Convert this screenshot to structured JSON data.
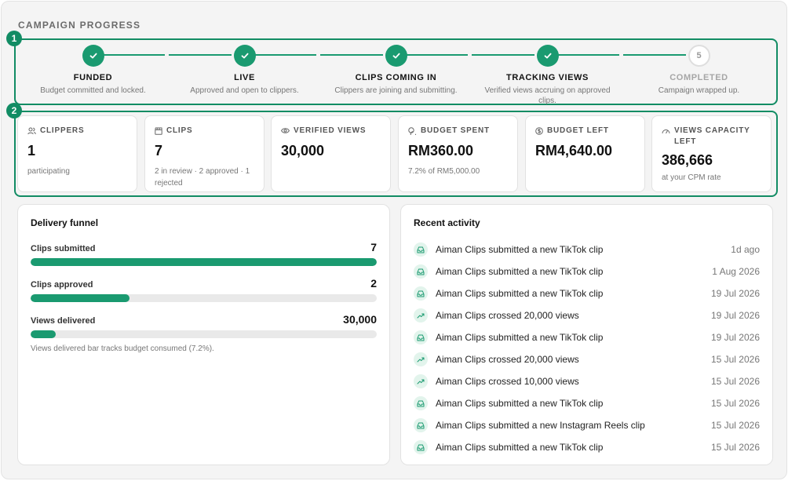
{
  "section_title": "CAMPAIGN PROGRESS",
  "markers": [
    "1",
    "2"
  ],
  "steps": [
    {
      "label": "FUNDED",
      "subtitle": "Budget committed and locked.",
      "state": "done"
    },
    {
      "label": "LIVE",
      "subtitle": "Approved and open to clippers.",
      "state": "done"
    },
    {
      "label": "CLIPS COMING IN",
      "subtitle": "Clippers are joining and submitting.",
      "state": "done"
    },
    {
      "label": "TRACKING VIEWS",
      "subtitle": "Verified views accruing on approved clips.",
      "state": "done"
    },
    {
      "label": "COMPLETED",
      "subtitle": "Campaign wrapped up.",
      "state": "pending",
      "number": "5"
    }
  ],
  "stats": [
    {
      "label": "CLIPPERS",
      "value": "1",
      "note": "participating",
      "icon": "users-icon"
    },
    {
      "label": "CLIPS",
      "value": "7",
      "note": "2 in review · 2 approved · 1 rejected",
      "icon": "clapperboard-icon"
    },
    {
      "label": "VERIFIED VIEWS",
      "value": "30,000",
      "note": "",
      "icon": "eye-icon"
    },
    {
      "label": "BUDGET SPENT",
      "value": "RM360.00",
      "note": "7.2% of RM5,000.00",
      "icon": "coins-icon"
    },
    {
      "label": "BUDGET LEFT",
      "value": "RM4,640.00",
      "note": "",
      "icon": "dollar-circle-icon"
    },
    {
      "label": "VIEWS CAPACITY LEFT",
      "value": "386,666",
      "note": "at your CPM rate",
      "icon": "gauge-icon"
    }
  ],
  "funnel": {
    "title": "Delivery funnel",
    "rows": [
      {
        "label": "Clips submitted",
        "value": "7",
        "fill_fraction": 1.0
      },
      {
        "label": "Clips approved",
        "value": "2",
        "fill_fraction": 0.2857
      },
      {
        "label": "Views delivered",
        "value": "30,000",
        "fill_fraction": 0.072
      }
    ],
    "note": "Views delivered bar tracks budget consumed (7.2%)."
  },
  "activity": {
    "title": "Recent activity",
    "items": [
      {
        "text": "Aiman Clips submitted a new TikTok clip",
        "time": "1d ago",
        "icon": "inbox-icon"
      },
      {
        "text": "Aiman Clips submitted a new TikTok clip",
        "time": "1 Aug 2026",
        "icon": "inbox-icon"
      },
      {
        "text": "Aiman Clips submitted a new TikTok clip",
        "time": "19 Jul 2026",
        "icon": "inbox-icon"
      },
      {
        "text": "Aiman Clips crossed 20,000 views",
        "time": "19 Jul 2026",
        "icon": "trending-up-icon"
      },
      {
        "text": "Aiman Clips submitted a new TikTok clip",
        "time": "19 Jul 2026",
        "icon": "inbox-icon"
      },
      {
        "text": "Aiman Clips crossed 20,000 views",
        "time": "15 Jul 2026",
        "icon": "trending-up-icon"
      },
      {
        "text": "Aiman Clips crossed 10,000 views",
        "time": "15 Jul 2026",
        "icon": "trending-up-icon"
      },
      {
        "text": "Aiman Clips submitted a new TikTok clip",
        "time": "15 Jul 2026",
        "icon": "inbox-icon"
      },
      {
        "text": "Aiman Clips submitted a new Instagram Reels clip",
        "time": "15 Jul 2026",
        "icon": "inbox-icon"
      },
      {
        "text": "Aiman Clips submitted a new TikTok clip",
        "time": "15 Jul 2026",
        "icon": "inbox-icon"
      }
    ]
  },
  "colors": {
    "accent": "#1a9a70",
    "marker": "#128c64",
    "track": "#e9e9e9"
  }
}
